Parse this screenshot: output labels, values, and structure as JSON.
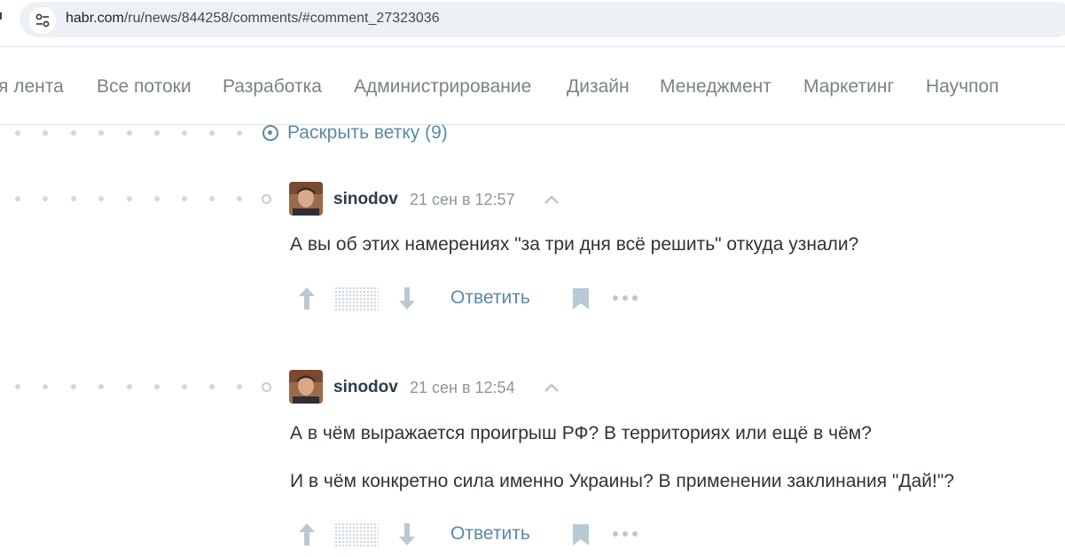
{
  "browser": {
    "url_host": "habr.com",
    "url_path": "/ru/news/844258/comments/#comment_27323036",
    "site_info_icon": "tune-icon"
  },
  "nav": {
    "items": [
      "я лента",
      "Все потоки",
      "Разработка",
      "Администрирование",
      "Дизайн",
      "Менеджмент",
      "Маркетинг",
      "Научпоп"
    ]
  },
  "thread": {
    "expand_label": "Раскрыть ветку (9)"
  },
  "comments": [
    {
      "author": "sinodov",
      "time": "21 сен в 12:57",
      "paragraphs": [
        "А вы об этих намерениях \"за три дня всё решить\" откуда узнали?"
      ],
      "reply_label": "Ответить"
    },
    {
      "author": "sinodov",
      "time": "21 сен в 12:54",
      "paragraphs": [
        "А в чём выражается проигрыш РФ? В территориях или ещё в чём?",
        "И в чём конкретно сила именно Украины? В применении заклинания \"Дай!\"?"
      ],
      "reply_label": "Ответить"
    }
  ],
  "colors": {
    "link": "#5a8aa6",
    "nav_text": "#7b8287",
    "body_text": "#2d3438",
    "muted": "#8d959b"
  }
}
